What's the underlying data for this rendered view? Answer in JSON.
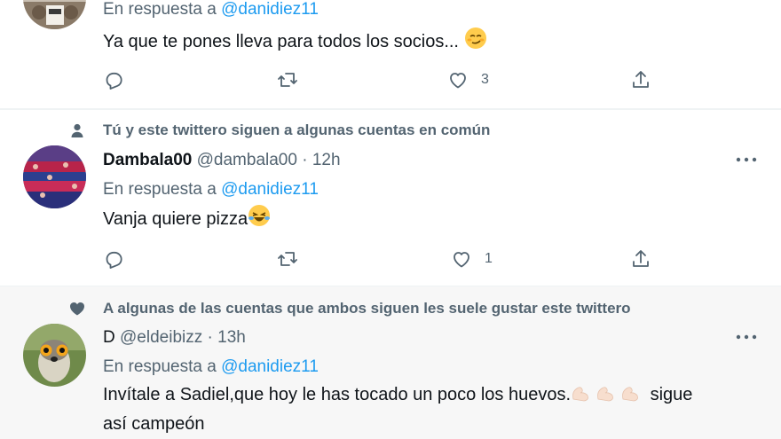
{
  "tweets": [
    {
      "avatar": "avatar-photo",
      "reply_prefix": "En respuesta a",
      "reply_to": "@danidiez11",
      "text": "Ya que te pones lleva para todos los socios...",
      "emoji": "smirk-emoji",
      "actions": {
        "reply_count": "",
        "retweet_count": "",
        "like_count": "3"
      }
    },
    {
      "context_icon": "person-icon",
      "context": "Tú y este twittero siguen a algunas cuentas en común",
      "name": "Dambala00",
      "handle": "@dambala00",
      "separator": "·",
      "time": "12h",
      "reply_prefix": "En respuesta a",
      "reply_to": "@danidiez11",
      "text": "Vanja quiere pizza",
      "emoji": "laughing-tears-emoji",
      "actions": {
        "reply_count": "",
        "retweet_count": "",
        "like_count": "1"
      }
    },
    {
      "context_icon": "heart-icon",
      "context": "A algunas de las cuentas que ambos siguen les suele gustar este twittero",
      "name": "D",
      "handle": "@eldeibizz",
      "separator": "·",
      "time": "13h",
      "reply_prefix": "En respuesta a",
      "reply_to": "@danidiez11",
      "text_a": "Invítale a Sadiel,que hoy le has tocado un poco los huevos.",
      "emoji": "flexed-biceps-emoji",
      "text_b": "sigue",
      "text_c": "así campeón"
    }
  ],
  "colors": {
    "text": "#0f1419",
    "secondary": "#536471",
    "link": "#1d9bf0",
    "border": "#eff3f4",
    "highlight_bg": "#f7f7f7"
  }
}
